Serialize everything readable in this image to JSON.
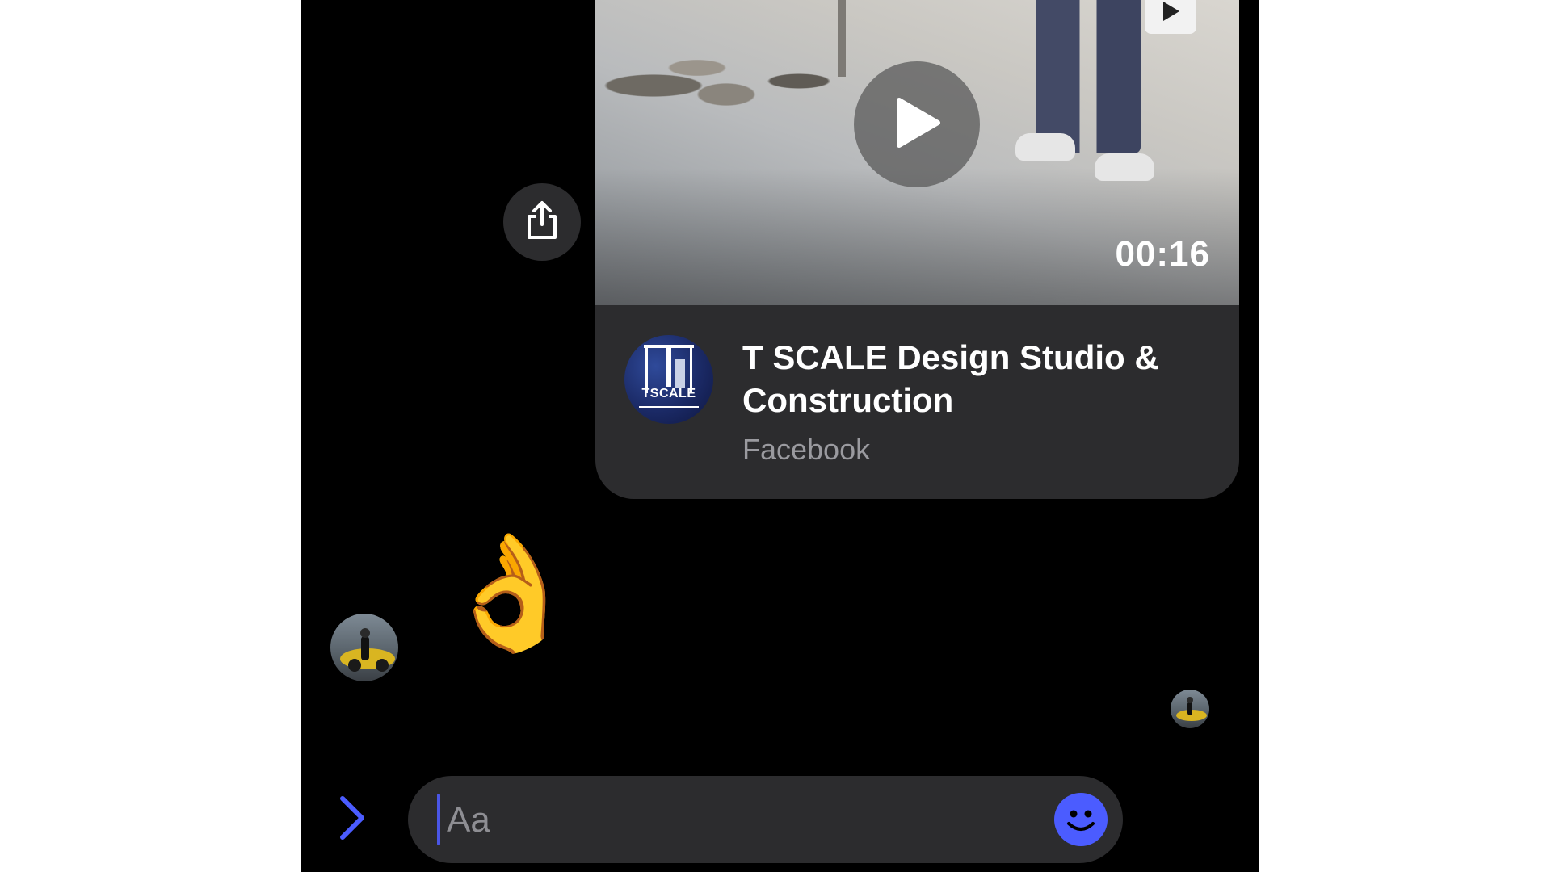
{
  "shared_post": {
    "duration": "00:16",
    "page_name": "T SCALE Design Studio & Construction",
    "source": "Facebook",
    "logo_text": "TSCALE"
  },
  "messages": {
    "received_emoji": "👌"
  },
  "composer": {
    "placeholder": "Aa",
    "like_emoji": "😄"
  },
  "icons": {
    "share": "share-icon",
    "play": "play-icon",
    "expand": "chevron-right-icon",
    "emoji_picker": "smiley-icon"
  },
  "colors": {
    "accent": "#4b5cff",
    "bubble": "#2c2c2e",
    "background": "#000000"
  }
}
